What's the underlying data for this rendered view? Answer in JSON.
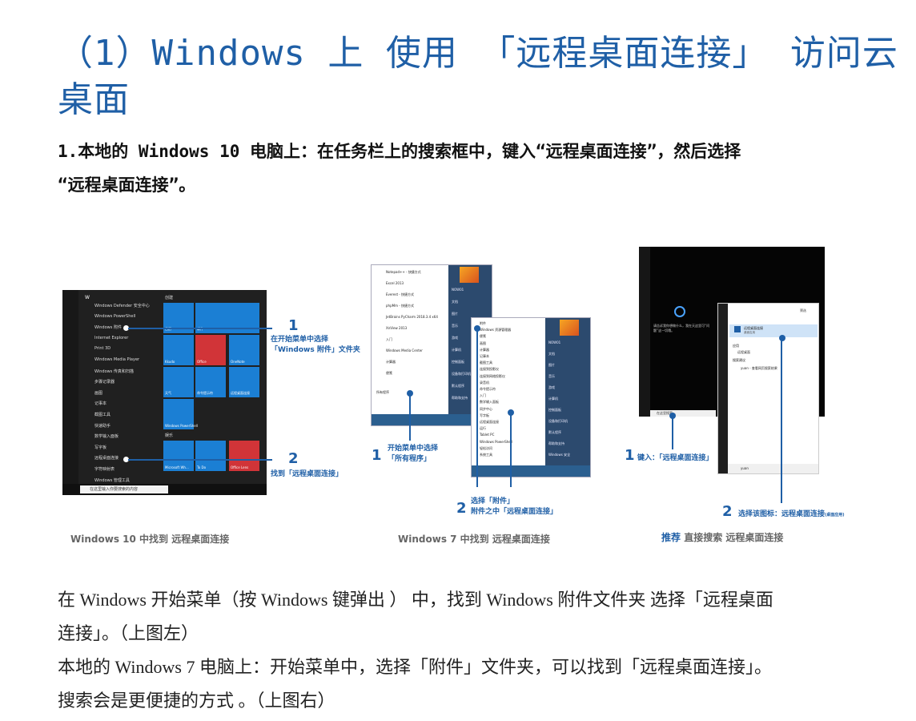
{
  "heading": {
    "line1": "（1）Windows 上 使用 「远程桌面连接」 访问云",
    "line2": "桌面"
  },
  "step1": {
    "line1": "1.本地的 Windows 10 电脑上：在任务栏上的搜索框中，键入“远程桌面连接”，然后选择",
    "line2": "“远程桌面连接”。"
  },
  "figure": {
    "win10": {
      "caption": "Windows 10 中找到 远程桌面连接",
      "callout1_num": "1",
      "callout1_line1": "在开始菜单中选择",
      "callout1_line2": "「Windows 附件」文件夹",
      "callout2_num": "2",
      "callout2_text": "找到「远程桌面连接」",
      "section_letter": "W",
      "menu_items": [
        "Windows Defender 安全中心",
        "Windows PowerShell",
        "Windows 附件",
        "Internet Explorer",
        "Print 3D",
        "Windows Media Player",
        "Windows 传真和扫描",
        "步骤记录器",
        "画图",
        "记事本",
        "截图工具",
        "快速助手",
        "数学输入面板",
        "写字板",
        "远程桌面连接",
        "字符映射表",
        "Windows 管理工具"
      ],
      "group_label_1": "创建",
      "group_label_2": "娱乐",
      "tile_labels": [
        "日历",
        "邮件",
        "Kkudo",
        "Office",
        "OneNote",
        "天气",
        "命令提示符",
        "远程桌面连接",
        "Windows PowerShell",
        "Microsoft Wh...",
        "To Do",
        "Office Lens"
      ],
      "search_placeholder": "在这里输入你要搜索的内容"
    },
    "win7": {
      "caption": "Windows 7 中找到 远程桌面连接",
      "callout1_num": "1",
      "callout1_line1": "开始菜单中选择",
      "callout1_line2": "「所有程序」",
      "callout2_num": "2",
      "callout2_line1": "选择「附件」",
      "callout2_line2": "附件之中「远程桌面连接」",
      "menu_a_items": [
        "Notepad++ - 快捷方式",
        "Excel 2013",
        "Everest - 快捷方式",
        "phpMm - 快捷方式",
        "JetBrains PyCharm 2018.3.4 x64",
        "XnView 2013",
        "入门",
        "Windows Media Center",
        "计算器",
        "便笺"
      ],
      "all_programs": "所有程序",
      "right_a_items": [
        "NOW01",
        "文档",
        "图片",
        "音乐",
        "游戏",
        "计算机",
        "控制面板",
        "设备和打印机",
        "默认程序",
        "帮助和支持"
      ],
      "menu_b_items": [
        "附件",
        "Windows 资源管理器",
        "便笺",
        "画图",
        "计算器",
        "记事本",
        "截图工具",
        "连接到投影仪",
        "连接到网络投影仪",
        "录音机",
        "命令提示符",
        "入门",
        "数学输入面板",
        "同步中心",
        "写字板",
        "远程桌面连接",
        "运行",
        "Tablet PC",
        "Windows PowerShell",
        "轻松访问",
        "系统工具"
      ],
      "right_b_items": [
        "NOW01",
        "文档",
        "图片",
        "音乐",
        "游戏",
        "计算机",
        "控制面板",
        "设备和打印机",
        "默认程序",
        "帮助和支持",
        "Windows 安全"
      ]
    },
    "search": {
      "caption_strong": "推荐",
      "caption_rest": " 直接搜索 远程桌面连接",
      "callout1_num": "1",
      "callout1_text": "键入：「远程桌面连接」",
      "callout2_num": "2",
      "callout2_text": "选择该图标：远程桌面连接",
      "callout2_suffix": "(桌面应用)",
      "cortana_text": "请告诉我你想做什么，我在天这里可“问题”这一切哦。",
      "search_prompt": "在这里搜索...",
      "best_match": "远程桌面连接",
      "best_match_sub": "桌面应用",
      "apps_label": "应用",
      "app_item": "远程桌面",
      "suggest_label": "搜索建议",
      "suggest_item": "yuan - 查看网页搜索结果",
      "query": "yuan",
      "panel_title": "筛选"
    }
  },
  "para1": {
    "line1": "在 Windows 开始菜单（按 Windows 键弹出 ） 中，找到 Windows 附件文件夹 选择「远程桌面",
    "line2": "连接」。（上图左）"
  },
  "para2": {
    "line1": "本地的 Windows 7 电脑上：开始菜单中，选择「附件」文件夹，可以找到「远程桌面连接」。",
    "line2": "搜索会是更便捷的方式 。（上图右）"
  },
  "colors": {
    "accent": "#1f5fa6",
    "tile_blue": "#1b7fd4",
    "tile_red": "#d13438"
  }
}
